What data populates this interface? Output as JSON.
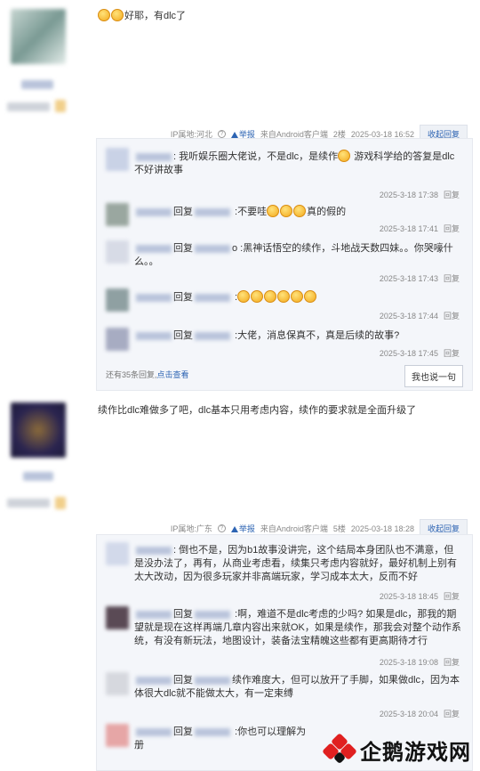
{
  "posts": [
    {
      "content": "好耶，有dlc了",
      "meta": {
        "ip": "IP属地:河北",
        "report": "举报",
        "source": "来自Android客户端",
        "floor": "2楼",
        "time": "2025-03-18 16:52",
        "fold": "收起回复"
      },
      "replies": [
        {
          "pre": "",
          "text": ": 我听娱乐圈大佬说，不是dlc，是续作",
          "text2": " 游戏科学给的答复是dlc不好讲故事",
          "time": "2025-3-18 17:38",
          "reply": "回复"
        },
        {
          "pre": "回复",
          "text": " :不要哇",
          "text2": "真的假的",
          "time": "2025-3-18 17:41",
          "reply": "回复"
        },
        {
          "pre": "回复",
          "text": "o :黑神话悟空的续作，斗地战天数四妹。。你哭嚎什么。。",
          "text2": "",
          "time": "2025-3-18 17:43",
          "reply": "回复"
        },
        {
          "pre": "回复",
          "text": " :",
          "text2": "",
          "time": "2025-3-18 17:44",
          "reply": "回复"
        },
        {
          "pre": "回复",
          "text": " :大佬，消息保真不，真是后续的故事?",
          "text2": "",
          "time": "2025-3-18 17:45",
          "reply": "回复"
        }
      ],
      "more_text": "还有35条回复,",
      "more_link": "点击查看",
      "say_button": "我也说一句"
    },
    {
      "content": "续作比dlc难做多了吧，dlc基本只用考虑内容，续作的要求就是全面升级了",
      "meta": {
        "ip": "IP属地:广东",
        "report": "举报",
        "source": "来自Android客户端",
        "floor": "5楼",
        "time": "2025-03-18 18:28",
        "fold": "收起回复"
      },
      "replies": [
        {
          "pre": "",
          "text": ": 倒也不是，因为b1故事没讲完，这个结局本身团队也不满意，但是没办法了，再有，从商业考虑看，续集只考虑内容就好，最好机制上别有太大改动，因为很多玩家并非高端玩家，学习成本太大，反而不好",
          "text2": "",
          "time": "2025-3-18 18:45",
          "reply": "回复"
        },
        {
          "pre": "回复",
          "text": " :啊，难道不是dlc考虑的少吗? 如果是dlc，那我的期望就是现在这样再端几章内容出来就OK，如果是续作，那我会对整个动作系统，有没有新玩法，地图设计，装备法宝精魄这些都有更高期待才行",
          "text2": "",
          "time": "2025-3-18 19:08",
          "reply": "回复"
        },
        {
          "pre": "回复",
          "text": "续作难度大，但可以放开了手脚，如果做dlc，因为本体很大dlc就不能做太大，有一定束缚",
          "text2": "",
          "time": "2025-3-18 20:04",
          "reply": "回复"
        },
        {
          "pre": "回复",
          "text": " :你也可以理解为",
          "text2": "册",
          "time": "",
          "reply": ""
        }
      ]
    }
  ],
  "watermark": {
    "text": "企鹅游戏网"
  },
  "colors": {
    "link": "#2d64b3",
    "box": "#f4f6fa",
    "logo": "#e02020"
  }
}
